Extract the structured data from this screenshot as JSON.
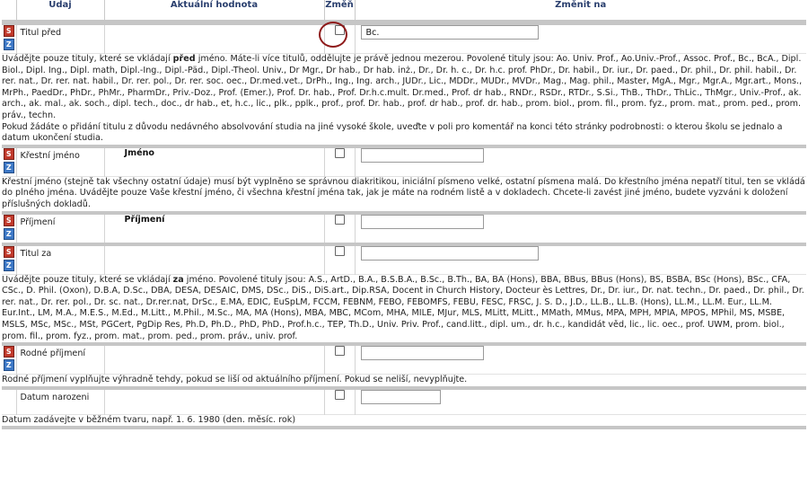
{
  "header": {
    "col_udaj": "Údaj",
    "col_aktualni": "Aktuální hodnota",
    "col_zmen": "Změň",
    "col_zmenit": "Změnit na"
  },
  "icons": {
    "s_label": "S",
    "z_label": "Z"
  },
  "rows": {
    "titul_pred": {
      "label": "Titul před",
      "value": "",
      "new_value": "Bc.",
      "help_prefix": "Uvádějte pouze tituly, které se vkládají ",
      "help_bold": "před",
      "help_rest": " jméno. Máte-li více titulů, oddělujte je právě jednou mezerou. Povolené tituly jsou: Ao. Univ. Prof., Ao.Univ.-Prof., Assoc. Prof., Bc., BcA., Dipl. Biol., Dipl. Ing., Dipl. math, Dipl.-Ing., Dipl.-Päd., Dipl.-Theol. Univ., Dr Mgr., Dr hab., Dr hab. inż., Dr., Dr. h. c., Dr. h.c. prof. PhDr., Dr. habil., Dr. iur., Dr. paed., Dr. phil., Dr. phil. habil., Dr. rer. nat., Dr. rer. nat. habil., Dr. rer. pol., Dr. rer. soc. oec., Dr.med.vet., DrPh., Ing., Ing. arch., JUDr., Lic., MDDr., MUDr., MVDr., Mag., Mag. phil., Master, MgA., Mgr., Mgr.A., Mgr.art., Mons., MrPh., PaedDr., PhDr., PhMr., PharmDr., Priv.-Doz., Prof. (Emer.), Prof. Dr. hab., Prof. Dr.h.c.mult. Dr.med., Prof. dr hab., RNDr., RSDr., RTDr., S.Si., ThB., ThDr., ThLic., ThMgr., Univ.-Prof., ak. arch., ak. mal., ak. soch., dipl. tech., doc., dr hab., et, h.c., lic., plk., pplk., prof., prof. Dr. hab., prof. dr hab., prof. dr. hab., prom. biol., prom. fil., prom. fyz., prom. mat., prom. ped., prom. práv., techn.",
      "help_line2": "Pokud žádáte o přidání titulu z důvodu nedávného absolvování studia na jiné vysoké škole, uveďte v poli pro komentář na konci této stránky podrobnosti: o kterou školu se jednalo a datum ukončení studia."
    },
    "krestni_jmeno": {
      "label": "Křestní jméno",
      "value": "Jméno",
      "new_value": "",
      "help": "Křestní jméno (stejně tak všechny ostatní údaje) musí být vyplněno se správnou diakritikou, iniciální písmeno velké, ostatní písmena malá. Do křestního jména nepatří titul, ten se vkládá do plného jména. Uvádějte pouze Vaše křestní jméno, či všechna křestní jména tak, jak je máte na rodném listě a v dokladech. Chcete-li zavést jiné jméno, budete vyzváni k doložení příslušných dokladů."
    },
    "prijmeni": {
      "label": "Příjmení",
      "value": "Příjmení",
      "new_value": ""
    },
    "titul_za": {
      "label": "Titul za",
      "value": "",
      "new_value": "",
      "help_prefix": "Uvádějte pouze tituly, které se vkládají ",
      "help_bold": "za",
      "help_rest": " jméno. Povolené tituly jsou: A.S., ArtD., B.A., B.S.B.A., B.Sc., B.Th., BA, BA (Hons), BBA, BBus, BBus (Hons), BS, BSBA, BSc (Hons), BSc., CFA, CSc., D. Phil. (Oxon), D.B.A, D.Sc., DBA, DESA, DESAIC, DMS, DSc., DiS., DiS.art., Dip.RSA, Docent in Church History, Docteur ès Lettres, Dr., Dr. iur., Dr. nat. techn., Dr. paed., Dr. phil., Dr. rer. nat., Dr. rer. pol., Dr. sc. nat., Dr.rer.nat, DrSc., E.MA, EDIC, EuSpLM, FCCM, FEBNM, FEBO, FEBOMFS, FEBU, FESC, FRSC, J. S. D., J.D., LL.B., LL.B. (Hons), LL.M., LL.M. Eur., LL.M. Eur.Int., LM, M.A., M.E.S., M.Ed., M.Litt., M.Phil., M.Sc., MA, MA (Hons), MBA, MBC, MCom, MHA, MILE, MJur, MLS, MLitt, MLitt., MMath, MMus, MPA, MPH, MPIA, MPOS, MPhil, MS, MSBE, MSLS, MSc, MSc., MSt, PGCert, PgDip Res, Ph.D, Ph.D., PhD, PhD., Prof.h.c., TEP, Th.D., Univ. Priv. Prof., cand.litt., dipl. um., dr. h.c., kandidát věd, lic., lic. oec., prof. UWM, prom. biol., prom. fil., prom. fyz., prom. mat., prom. ped., prom. práv., univ. prof."
    },
    "rodne_prijmeni": {
      "label": "Rodné příjmení",
      "value": "",
      "new_value": "",
      "help": "Rodné příjmení vyplňujte výhradně tehdy, pokud se liší od aktuálního příjmení. Pokud se neliší, nevyplňujte."
    },
    "datum_narozeni": {
      "label": "Datum narozeni",
      "value": "",
      "new_value": "",
      "help": "Datum zadávejte v běžném tvaru, např. 1. 6. 1980 (den. měsíc. rok)"
    }
  }
}
